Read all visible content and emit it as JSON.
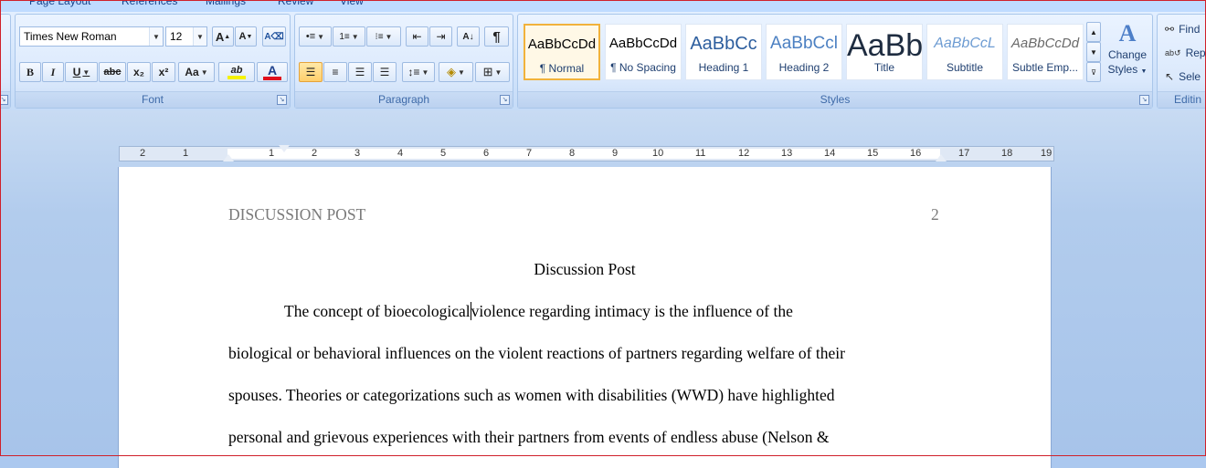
{
  "ribbon_tabs": [
    "Page Layout",
    "References",
    "Mailings",
    "Review",
    "View"
  ],
  "font": {
    "name": "Times New Roman",
    "size": "12",
    "grow_label": "A",
    "shrink_label": "A",
    "bold": "B",
    "italic": "I",
    "underline": "U",
    "strikethrough": "abc",
    "subscript": "x₂",
    "superscript": "x²",
    "change_case": "Aa",
    "highlight": "ab",
    "font_color": "A",
    "group_label": "Font"
  },
  "paragraph": {
    "group_label": "Paragraph",
    "show_marks": "¶"
  },
  "styles": {
    "group_label": "Styles",
    "items": [
      {
        "sample": "AaBbCcDd",
        "name": "¶ Normal"
      },
      {
        "sample": "AaBbCcDd",
        "name": "¶ No Spacing"
      },
      {
        "sample": "AaBbCc",
        "name": "Heading 1"
      },
      {
        "sample": "AaBbCcl",
        "name": "Heading 2"
      },
      {
        "sample": "AaBb",
        "name": "Title"
      },
      {
        "sample": "AaBbCcL",
        "name": "Subtitle"
      },
      {
        "sample": "AaBbCcDd",
        "name": "Subtle Emp..."
      }
    ],
    "change_styles": "Change Styles",
    "change_styles_line1": "Change",
    "change_styles_line2": "Styles"
  },
  "editing": {
    "group_label": "Editin",
    "find": "Find",
    "replace": "Rep",
    "select": "Sele"
  },
  "ruler_numbers": [
    "2",
    "1",
    "1",
    "1",
    "2",
    "3",
    "4",
    "5",
    "6",
    "7",
    "8",
    "9",
    "10",
    "11",
    "12",
    "13",
    "14",
    "15",
    "16",
    "17",
    "18",
    "19"
  ],
  "document": {
    "running_head": "DISCUSSION POST",
    "page_number": "2",
    "title": "Discussion Post",
    "line1_before_caret": "The concept of bioecological",
    "line1_after_caret": "violence regarding intimacy is the influence of the",
    "lines": [
      "biological or behavioral influences on the violent reactions of partners regarding welfare of their",
      "spouses. Theories or categorizations such as women with disabilities (WWD) have highlighted",
      "personal and grievous experiences with their partners from events of endless abuse (Nelson &"
    ]
  },
  "colors": {
    "highlight_bar": "#f5f200",
    "font_color_bar": "#e0101b",
    "selected_style_border": "#f1b23b"
  }
}
